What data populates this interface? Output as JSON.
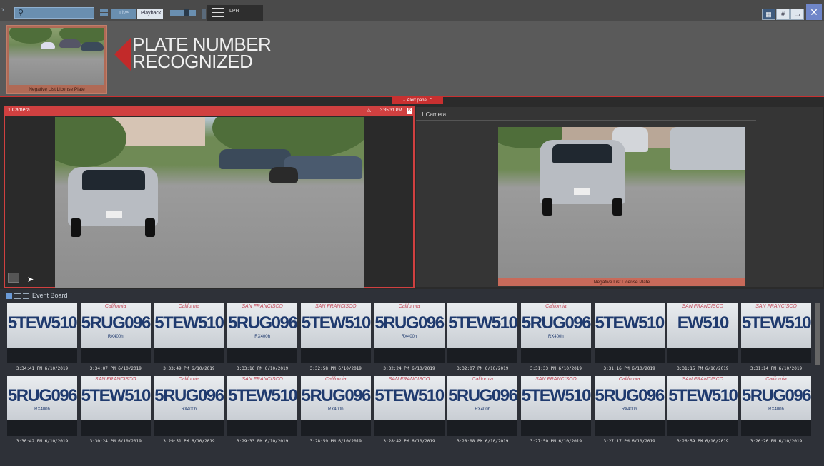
{
  "toolbar": {
    "search_placeholder": "",
    "live_label": "Live",
    "playback_label": "Playback",
    "layout_tab_label": "LPR"
  },
  "alert": {
    "thumb_caption": "Negative List License Plate",
    "headline_line1": "PLATE NUMBER",
    "headline_line2": "RECOGNIZED",
    "panel_button": "Alert panel"
  },
  "camera_left": {
    "title": "1.Camera",
    "time": "3:35:31 PM",
    "rec": "R"
  },
  "camera_right": {
    "title": "1.Camera",
    "caption": "Negative List License Plate"
  },
  "event_board": {
    "title": "Event Board",
    "rows": [
      [
        {
          "plate": "5TEW510",
          "state": "",
          "sub": "",
          "time": "3:34:41 PM 6/10/2019"
        },
        {
          "plate": "5RUG096",
          "state": "California",
          "sub": "RX400h",
          "time": "3:34:07 PM 6/10/2019"
        },
        {
          "plate": "5TEW510",
          "state": "California",
          "sub": "",
          "time": "3:33:49 PM 6/10/2019"
        },
        {
          "plate": "5RUG096",
          "state": "SAN FRANCISCO",
          "sub": "RX400h",
          "time": "3:33:16 PM 6/10/2019"
        },
        {
          "plate": "5TEW510",
          "state": "SAN FRANCISCO",
          "sub": "",
          "time": "3:32:58 PM 6/10/2019"
        },
        {
          "plate": "5RUG096",
          "state": "California",
          "sub": "RX400h",
          "time": "3:32:24 PM 6/10/2019"
        },
        {
          "plate": "5TEW510",
          "state": "",
          "sub": "",
          "time": "3:32:07 PM 6/10/2019"
        },
        {
          "plate": "5RUG096",
          "state": "California",
          "sub": "RX400h",
          "time": "3:31:33 PM 6/10/2019"
        },
        {
          "plate": "5TEW510",
          "state": "",
          "sub": "",
          "time": "3:31:16 PM 6/10/2019"
        },
        {
          "plate": "EW510",
          "state": "SAN FRANCISCO",
          "sub": "",
          "time": "3:31:15 PM 6/10/2019"
        },
        {
          "plate": "5TEW510",
          "state": "SAN FRANCISCO",
          "sub": "",
          "time": "3:31:14 PM 6/10/2019"
        }
      ],
      [
        {
          "plate": "5RUG096",
          "state": "",
          "sub": "RX400h",
          "time": "3:30:42 PM 6/10/2019"
        },
        {
          "plate": "5TEW510",
          "state": "SAN FRANCISCO",
          "sub": "",
          "time": "3:30:24 PM 6/10/2019"
        },
        {
          "plate": "5RUG096",
          "state": "California",
          "sub": "RX400h",
          "time": "3:29:51 PM 6/10/2019"
        },
        {
          "plate": "5TEW510",
          "state": "SAN FRANCISCO",
          "sub": "",
          "time": "3:29:33 PM 6/10/2019"
        },
        {
          "plate": "5RUG096",
          "state": "California",
          "sub": "RX400h",
          "time": "3:28:59 PM 6/10/2019"
        },
        {
          "plate": "5TEW510",
          "state": "SAN FRANCISCO",
          "sub": "",
          "time": "3:28:42 PM 6/10/2019"
        },
        {
          "plate": "5RUG096",
          "state": "California",
          "sub": "RX400h",
          "time": "3:28:08 PM 6/10/2019"
        },
        {
          "plate": "5TEW510",
          "state": "SAN FRANCISCO",
          "sub": "",
          "time": "3:27:50 PM 6/10/2019"
        },
        {
          "plate": "5RUG096",
          "state": "California",
          "sub": "RX400h",
          "time": "3:27:17 PM 6/10/2019"
        },
        {
          "plate": "5TEW510",
          "state": "SAN FRANCISCO",
          "sub": "",
          "time": "3:26:59 PM 6/10/2019"
        },
        {
          "plate": "5RUG096",
          "state": "California",
          "sub": "RX400h",
          "time": "3:26:26 PM 6/10/2019"
        }
      ]
    ]
  },
  "colors": {
    "alert_red": "#c83030",
    "accent_blue": "#6a8fb0",
    "plate_text": "#1f3a6e"
  }
}
